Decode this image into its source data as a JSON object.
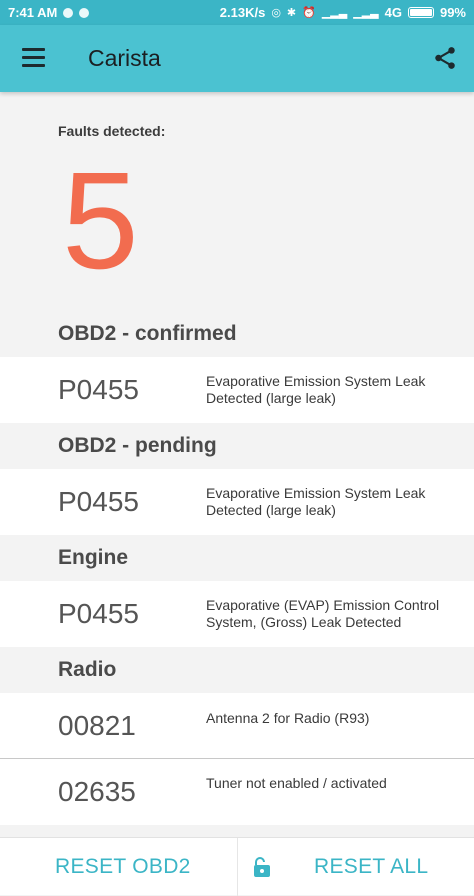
{
  "status_bar": {
    "time": "7:41 AM",
    "network_speed": "2.13K/s",
    "network_type": "4G",
    "battery": "99%",
    "battery_level": 0.99
  },
  "app_bar": {
    "title": "Carista",
    "menu_icon": "hamburger-menu-icon",
    "share_icon": "share-icon"
  },
  "summary": {
    "faults_label": "Faults detected:",
    "faults_count": "5",
    "count_color": "#f26c4f"
  },
  "sections": [
    {
      "title": "OBD2 - confirmed",
      "faults": [
        {
          "code": "P0455",
          "description": "Evaporative Emission System Leak Detected (large leak)"
        }
      ]
    },
    {
      "title": "OBD2 - pending",
      "faults": [
        {
          "code": "P0455",
          "description": "Evaporative Emission System Leak Detected (large leak)"
        }
      ]
    },
    {
      "title": "Engine",
      "faults": [
        {
          "code": "P0455",
          "description": "Evaporative (EVAP) Emission Control System, (Gross) Leak Detected"
        }
      ]
    },
    {
      "title": "Radio",
      "faults": [
        {
          "code": "00821",
          "description": "Antenna 2 for Radio (R93)"
        },
        {
          "code": "02635",
          "description": "Tuner not enabled / activated"
        }
      ]
    }
  ],
  "actions": {
    "reset_obd2": "RESET OBD2",
    "reset_all": "RESET ALL",
    "accent_color": "#3bb5c6"
  }
}
